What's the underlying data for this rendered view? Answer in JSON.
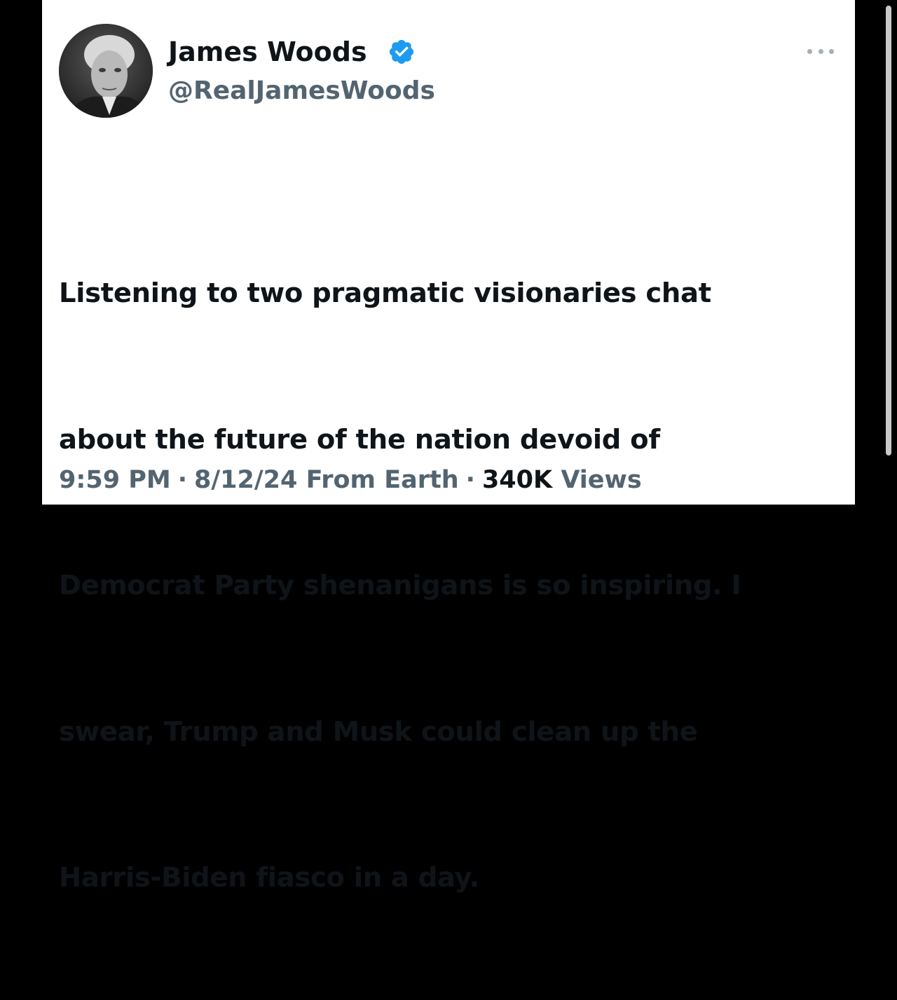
{
  "tweet": {
    "author": {
      "display_name": "James Woods",
      "handle": "@RealJamesWoods",
      "verified": true,
      "avatar_icon": "profile-photo"
    },
    "text_lines": [
      "Listening to two pragmatic visionaries chat",
      "about the future of the nation devoid of",
      "Democrat Party shenanigans is so inspiring. I",
      "swear, Trump and Musk could clean up the",
      "Harris-Biden fiasco in a day."
    ],
    "time": "9:59 PM",
    "separator": "·",
    "date": "8/12/24",
    "source": "From Earth",
    "views_count": "340K",
    "views_label": "Views"
  },
  "colors": {
    "text_primary": "#0f1419",
    "text_secondary": "#536471",
    "verified_blue": "#1d9bf0",
    "background": "#ffffff",
    "letterbox": "#000000"
  }
}
